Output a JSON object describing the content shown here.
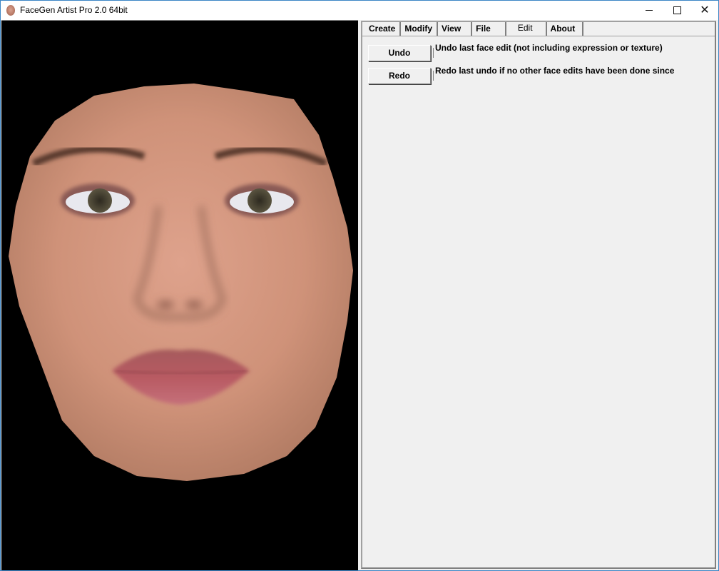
{
  "window": {
    "title": "FaceGen Artist Pro 2.0 64bit",
    "app_icon": "face-icon",
    "controls": {
      "minimize": "minimize-icon",
      "maximize": "maximize-icon",
      "close": "close-icon"
    }
  },
  "viewport": {
    "content": "3D face model render, frontal view",
    "background_color": "#000000"
  },
  "tabs": [
    {
      "label": "Create",
      "active": false
    },
    {
      "label": "Modify",
      "active": false
    },
    {
      "label": "View",
      "active": false
    },
    {
      "label": "File",
      "active": false
    },
    {
      "label": "Edit",
      "active": true
    },
    {
      "label": "About",
      "active": false
    }
  ],
  "edit_panel": {
    "undo": {
      "label": "Undo",
      "description": "Undo last face edit (not including expression or texture)"
    },
    "redo": {
      "label": "Redo",
      "description": "Redo last undo if no other face edits have been done since"
    }
  },
  "colors": {
    "accent_border": "#3c86c6",
    "panel_bg": "#f0f0f0",
    "skin": "#d9a08a"
  }
}
